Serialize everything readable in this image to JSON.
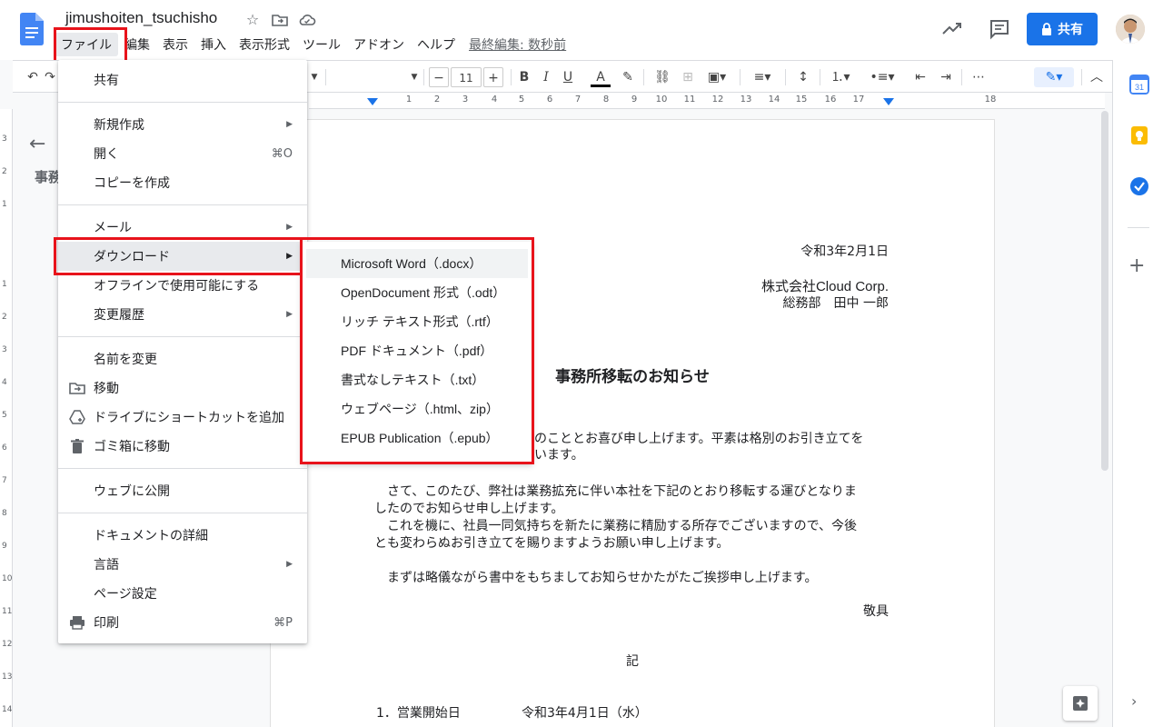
{
  "app": {
    "title": "jimushoiten_tsuchisho",
    "menus": [
      "ファイル",
      "編集",
      "表示",
      "挿入",
      "表示形式",
      "ツール",
      "アドオン",
      "ヘルプ"
    ],
    "last_edit": "最終編集: 数秒前",
    "share_label": "共有"
  },
  "toolbar": {
    "font_size": "11"
  },
  "ruler": {
    "ticks": [
      "1",
      "2",
      "3",
      "4",
      "5",
      "6",
      "7",
      "8",
      "9",
      "10",
      "11",
      "12",
      "13",
      "14",
      "15",
      "16",
      "17",
      "18"
    ],
    "vticks": [
      "3",
      "2",
      "1",
      "1",
      "2",
      "3",
      "4",
      "5",
      "6",
      "7",
      "8",
      "9",
      "10",
      "11",
      "12",
      "13",
      "14"
    ]
  },
  "outline": {
    "heading": "事務"
  },
  "document": {
    "date": "令和3年2月1日",
    "company": "株式会社Cloud Corp.",
    "sender": "総務部　田中 一郎",
    "heading": "事務所移転のお知らせ",
    "p1_line1_tail": "のこととお喜び申し上げます。平素は格別のお引き立てを",
    "p1_line2_tail": "います。",
    "p2_line1": "さて、このたび、弊社は業務拡充に伴い本社を下記のとおり移転する運びとなりま",
    "p2_line2": "したのでお知らせ申し上げます。",
    "p2_line3": "これを機に、社員一同気持ちを新たに業務に精励する所存でございますので、今後",
    "p2_line4": "とも変わらぬお引き立てを賜りますようお願い申し上げます。",
    "p3": "まずは略儀ながら書中をもちましてお知らせかたがたご挨拶申し上げます。",
    "closing": "敬具",
    "ki": "記",
    "item1_label": "1．営業開始日",
    "item1_value": "令和3年4月1日（水）"
  },
  "file_menu": {
    "items": [
      {
        "label": "共有"
      },
      {
        "label": "新規作成",
        "submenu": true
      },
      {
        "label": "開く",
        "shortcut": "⌘O"
      },
      {
        "label": "コピーを作成"
      },
      {
        "label": "メール",
        "submenu": true
      },
      {
        "label": "ダウンロード",
        "submenu": true
      },
      {
        "label": "オフラインで使用可能にする"
      },
      {
        "label": "変更履歴",
        "submenu": true
      },
      {
        "label": "名前を変更"
      },
      {
        "label": "移動",
        "icon": "move-folder-icon"
      },
      {
        "label": "ドライブにショートカットを追加",
        "icon": "drive-shortcut-icon"
      },
      {
        "label": "ゴミ箱に移動",
        "icon": "trash-icon"
      },
      {
        "label": "ウェブに公開"
      },
      {
        "label": "ドキュメントの詳細"
      },
      {
        "label": "言語",
        "submenu": true
      },
      {
        "label": "ページ設定"
      },
      {
        "label": "印刷",
        "shortcut": "⌘P",
        "icon": "print-icon"
      }
    ]
  },
  "download_menu": {
    "items": [
      "Microsoft Word（.docx）",
      "OpenDocument 形式（.odt）",
      "リッチ テキスト形式（.rtf）",
      "PDF ドキュメント（.pdf）",
      "書式なしテキスト（.txt）",
      "ウェブページ（.html、zip）",
      "EPUB Publication（.epub）"
    ]
  },
  "colors": {
    "accent": "#1a73e8",
    "highlight_box": "#e8131b",
    "docs_blue": "#4285f4"
  }
}
